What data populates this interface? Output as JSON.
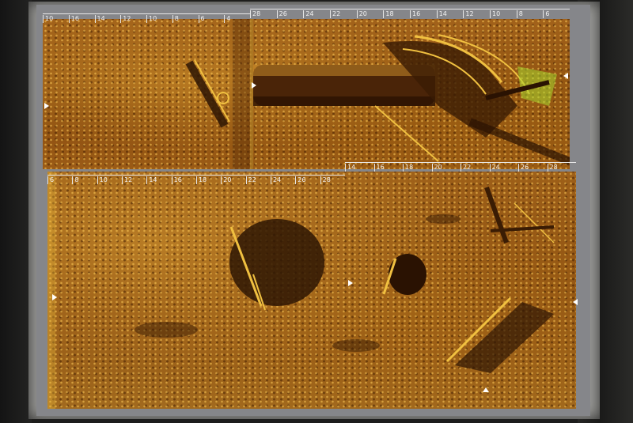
{
  "screen": {
    "top_ruler_left": [
      "10",
      "16",
      "14",
      "12",
      "10",
      "8",
      "6",
      "4"
    ],
    "top_ruler_right": [
      "28",
      "26",
      "24",
      "22",
      "20",
      "18",
      "16",
      "14",
      "12",
      "10",
      "8",
      "6"
    ],
    "bottom_ruler_left": [
      "6",
      "8",
      "10",
      "12",
      "14",
      "16",
      "18",
      "20",
      "22",
      "24",
      "26",
      "28"
    ],
    "bottom_ruler_right": [
      "14",
      "16",
      "18",
      "20",
      "22",
      "24",
      "26",
      "28"
    ]
  },
  "colors": {
    "sonar_base": "#9a5a15",
    "sonar_highlight": "#f0c040",
    "sonar_shadow": "#3a1c04",
    "green_highlight": "#a8d830",
    "ruler": "#f2f2f2"
  }
}
